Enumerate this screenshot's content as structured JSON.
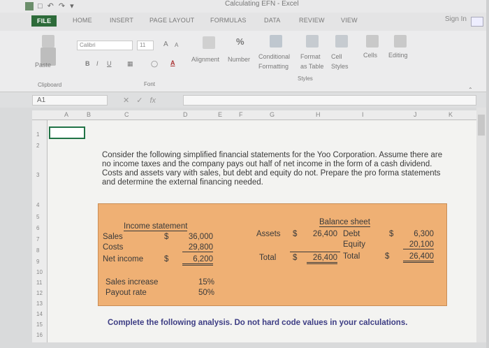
{
  "app": {
    "title": "Calculating EFN - Excel",
    "sign_in": "Sign In"
  },
  "tabs": [
    "FILE",
    "HOME",
    "INSERT",
    "PAGE LAYOUT",
    "FORMULAS",
    "DATA",
    "REVIEW",
    "VIEW"
  ],
  "ribbon": {
    "paste_label": "Paste",
    "clipboard_group": "Clipboard",
    "font_name": "Calibri",
    "font_size": "11",
    "bold": "B",
    "italic": "I",
    "underline": "U",
    "grow_font": "A",
    "shrink_font": "A",
    "font_color": "A",
    "font_group": "Font",
    "alignment": "Alignment",
    "number": "Number",
    "percent": "%",
    "conditional_formatting": "Conditional Formatting",
    "format_as_table": "Format as Table",
    "cell_styles": "Cell Styles",
    "styles_group": "Styles",
    "cells": "Cells",
    "editing": "Editing"
  },
  "formula_bar": {
    "name_box": "A1",
    "fx": "fx"
  },
  "columns": [
    "A",
    "B",
    "C",
    "D",
    "E",
    "F",
    "G",
    "H",
    "I",
    "J",
    "K"
  ],
  "rows": [
    "1",
    "2",
    "3",
    "4",
    "5",
    "6",
    "7",
    "8",
    "9",
    "10",
    "11",
    "12",
    "13",
    "14",
    "15",
    "16"
  ],
  "question": "Consider the following simplified financial statements for the Yoo Corporation. Assume there are no income taxes and the company pays out half of net income in the form of a cash dividend. Costs and assets vary with sales, but debt and equity do not. Prepare the pro forma statements and determine the external financing needed.",
  "income_statement": {
    "title": "Income statement",
    "rows": [
      {
        "label": "Sales",
        "currency": "$",
        "value": "36,000"
      },
      {
        "label": "Costs",
        "currency": "",
        "value": "29,800"
      },
      {
        "label": "Net income",
        "currency": "$",
        "value": "6,200"
      }
    ]
  },
  "balance_sheet": {
    "title": "Balance sheet",
    "assets_label": "Assets",
    "assets_currency": "$",
    "assets_value": "26,400",
    "total_label": "Total",
    "total_currency": "$",
    "total_assets": "26,400",
    "debt_label": "Debt",
    "debt_currency": "$",
    "debt_value": "6,300",
    "equity_label": "Equity",
    "equity_value": "20,100",
    "total_right_label": "Total",
    "total_right_currency": "$",
    "total_right_value": "26,400"
  },
  "assumptions": [
    {
      "label": "Sales increase",
      "value": "15%"
    },
    {
      "label": "Payout rate",
      "value": "50%"
    }
  ],
  "instruction": "Complete the following analysis. Do not hard code values in your calculations.",
  "colors": {
    "file_tab": "#2d6b3a",
    "box_fill": "#efb074",
    "instruction": "#3d3d84"
  }
}
